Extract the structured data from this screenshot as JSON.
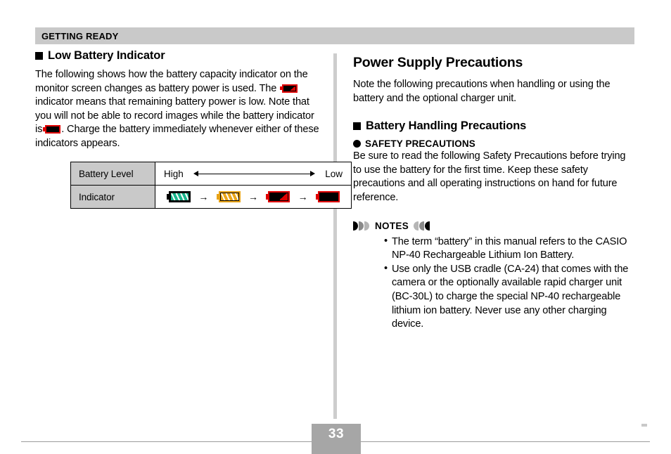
{
  "header": {
    "running_head": "GETTING READY"
  },
  "left_column": {
    "heading": "Low Battery Indicator",
    "body_part1": "The following shows how the battery capacity indicator on the monitor screen changes as battery power is used. The",
    "body_part2": "indicator means that remaining battery power is low. Note that you will not be able to record images while the battery indicator is",
    "body_part3": ". Charge the battery immediately whenever either of these indicators appears.",
    "table": {
      "row_labels": [
        "Battery Level",
        "Indicator"
      ],
      "level_high": "High",
      "level_low": "Low",
      "sequence_arrow": "→",
      "indicators": [
        "battery-full-green-icon",
        "battery-medium-orange-icon",
        "battery-low-red-icon",
        "battery-empty-red-icon"
      ]
    }
  },
  "right_column": {
    "heading": "Power Supply Precautions",
    "intro": "Note the following precautions when handling or using the battery and the optional charger unit.",
    "subheading": "Battery Handling Precautions",
    "safety_title": "SAFETY PRECAUTIONS",
    "safety_body": "Be sure to read the following Safety Precautions before trying to use the battery for the first time. Keep these safety precautions and all operating instructions on hand for future reference.",
    "notes_label": "NOTES",
    "notes": [
      "The term “battery” in this manual refers to the CASIO NP-40 Rechargeable Lithium Ion Battery.",
      "Use only the USB cradle (CA-24) that comes with the camera or the optionally available rapid charger unit (BC-30L) to charge the special NP-40 rechargeable lithium ion battery. Never use any other charging device."
    ]
  },
  "footer": {
    "page_number": "33"
  },
  "colors": {
    "header_bar": "#c9c9c9",
    "table_label_bg": "#c9c9c9",
    "divider": "#cdcdcd",
    "page_box": "#a6a6a6",
    "battery_green": "#19b58c",
    "battery_orange": "#eaa61a",
    "battery_red": "#e00000"
  }
}
